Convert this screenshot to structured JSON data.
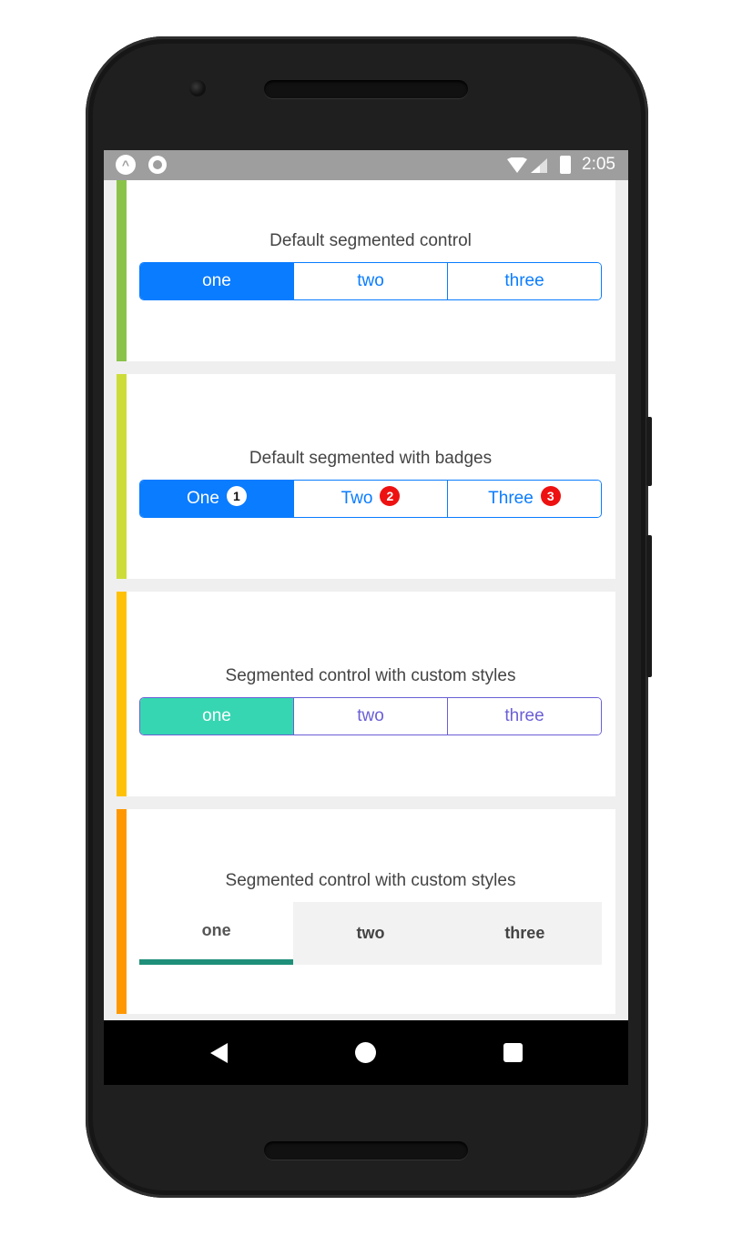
{
  "status_bar": {
    "app_icon": "a-icon",
    "record_icon": "record-icon",
    "time": "2:05"
  },
  "cards": [
    {
      "title": "Default segmented control",
      "accent": "#8bc34a",
      "tabs": [
        {
          "label": "one",
          "selected": true
        },
        {
          "label": "two",
          "selected": false
        },
        {
          "label": "three",
          "selected": false
        }
      ]
    },
    {
      "title": "Default segmented with badges",
      "accent": "#cddc39",
      "tabs": [
        {
          "label": "One",
          "badge": "1",
          "selected": true
        },
        {
          "label": "Two",
          "badge": "2",
          "selected": false
        },
        {
          "label": "Three",
          "badge": "3",
          "selected": false
        }
      ]
    },
    {
      "title": "Segmented control  with custom styles",
      "accent": "#ffc107",
      "tabs": [
        {
          "label": "one",
          "selected": true
        },
        {
          "label": "two",
          "selected": false
        },
        {
          "label": "three",
          "selected": false
        }
      ]
    },
    {
      "title": "Segmented control with custom styles",
      "accent": "#ff9800",
      "tabs": [
        {
          "label": "one",
          "selected": true
        },
        {
          "label": "two",
          "selected": false
        },
        {
          "label": "three",
          "selected": false
        }
      ]
    }
  ],
  "colors": {
    "primary_blue": "#0a7cff",
    "badge_red": "#ee1111",
    "custom_active": "#37d6b2",
    "custom_border": "#6a5fd6",
    "underline": "#1f8f79"
  },
  "nav_bar": {
    "back": "back-icon",
    "home": "home-icon",
    "recents": "recents-icon"
  }
}
